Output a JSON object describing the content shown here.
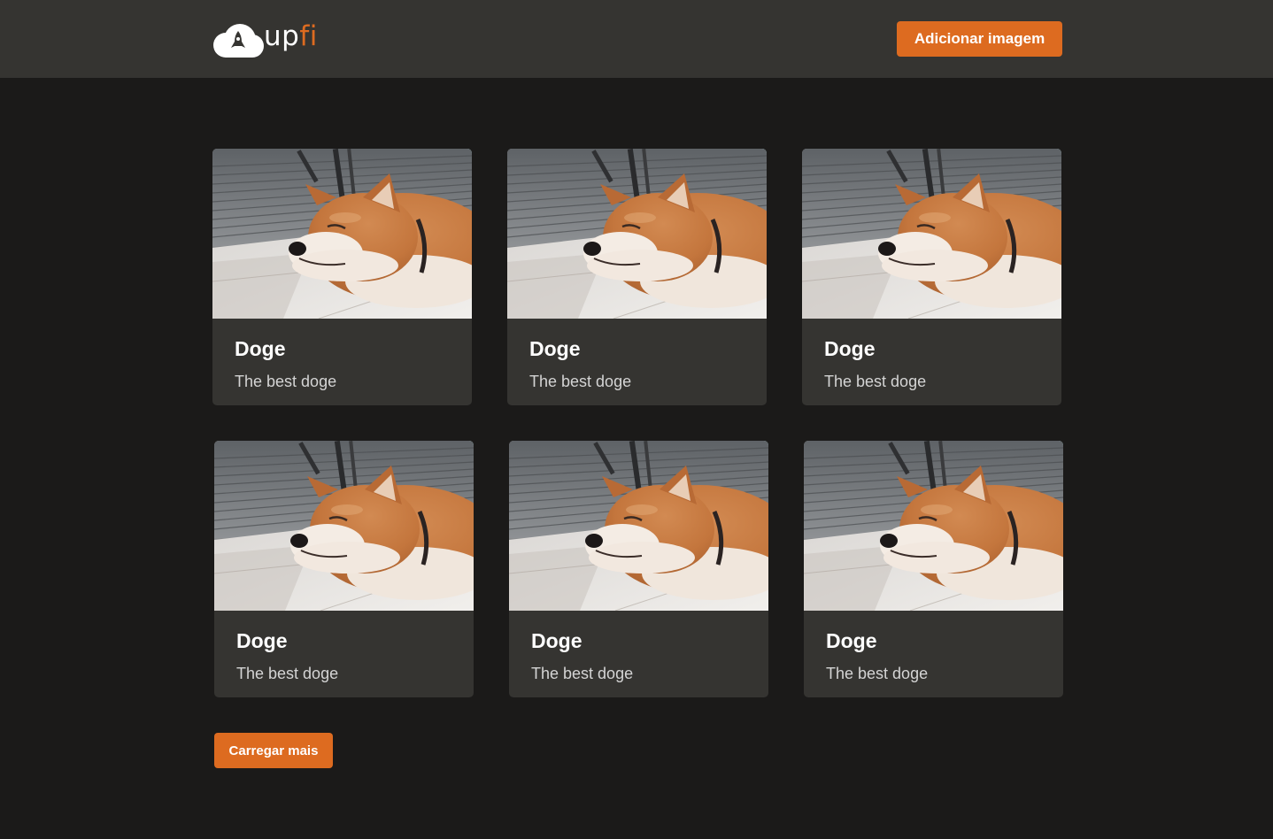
{
  "header": {
    "logo": {
      "text_up": "up",
      "text_fi": "fi",
      "icon": "rocket-cloud-icon"
    },
    "add_image_label": "Adicionar imagem"
  },
  "cards": [
    {
      "title": "Doge",
      "description": "The best doge",
      "image": "sleeping-shiba-inu-photo"
    },
    {
      "title": "Doge",
      "description": "The best doge",
      "image": "sleeping-shiba-inu-photo"
    },
    {
      "title": "Doge",
      "description": "The best doge",
      "image": "sleeping-shiba-inu-photo"
    },
    {
      "title": "Doge",
      "description": "The best doge",
      "image": "sleeping-shiba-inu-photo"
    },
    {
      "title": "Doge",
      "description": "The best doge",
      "image": "sleeping-shiba-inu-photo"
    },
    {
      "title": "Doge",
      "description": "The best doge",
      "image": "sleeping-shiba-inu-photo"
    }
  ],
  "load_more_label": "Carregar mais",
  "colors": {
    "accent": "#dd6b20",
    "page_background": "#1b1a19",
    "header_background": "#353431",
    "card_background": "#353431"
  }
}
